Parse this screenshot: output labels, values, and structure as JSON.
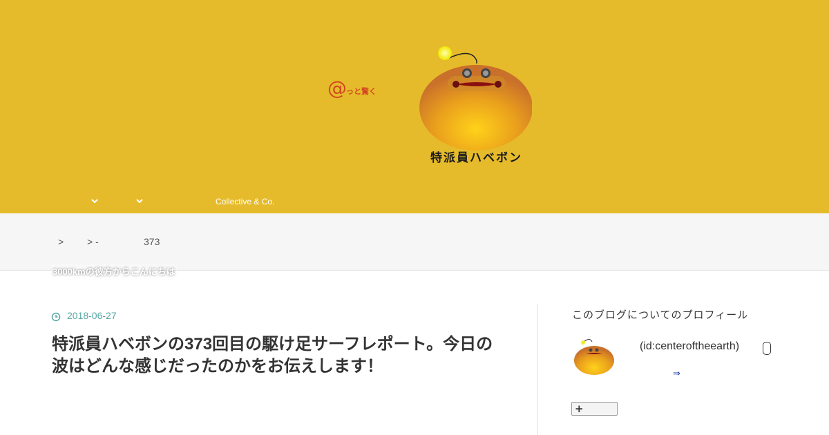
{
  "header": {
    "logo_at_mark": "@",
    "logo_tagline": "っと驚く",
    "brand_name": "特派員ハベボン",
    "nav": {
      "items": [
        {
          "label": "",
          "icon": "chevron-down-icon"
        },
        {
          "label": "",
          "icon": "chevron-down-icon"
        },
        {
          "label": "Collective & Co."
        }
      ]
    }
  },
  "breadcrumb": {
    "sep1": ">",
    "sep2": "> -",
    "current": "373"
  },
  "category_badge": "3000kmの彼方からこんにちは",
  "article": {
    "date": "2018-06-27",
    "title": "特派員ハベボンの373回目の駆け足サーフレポート。今日の波はどんな感じだったのかをお伝えします！"
  },
  "sidebar": {
    "title": "このブログについてのプロフィール",
    "profile_id": "(id:centeroftheearth)",
    "more_arrow": "⇒",
    "follow_label": "+"
  },
  "colors": {
    "header_bg": "#e6bb2b",
    "accent_date": "#55a7a2",
    "logo_at": "#d2481e",
    "link_arrow": "#1c3fa6"
  }
}
